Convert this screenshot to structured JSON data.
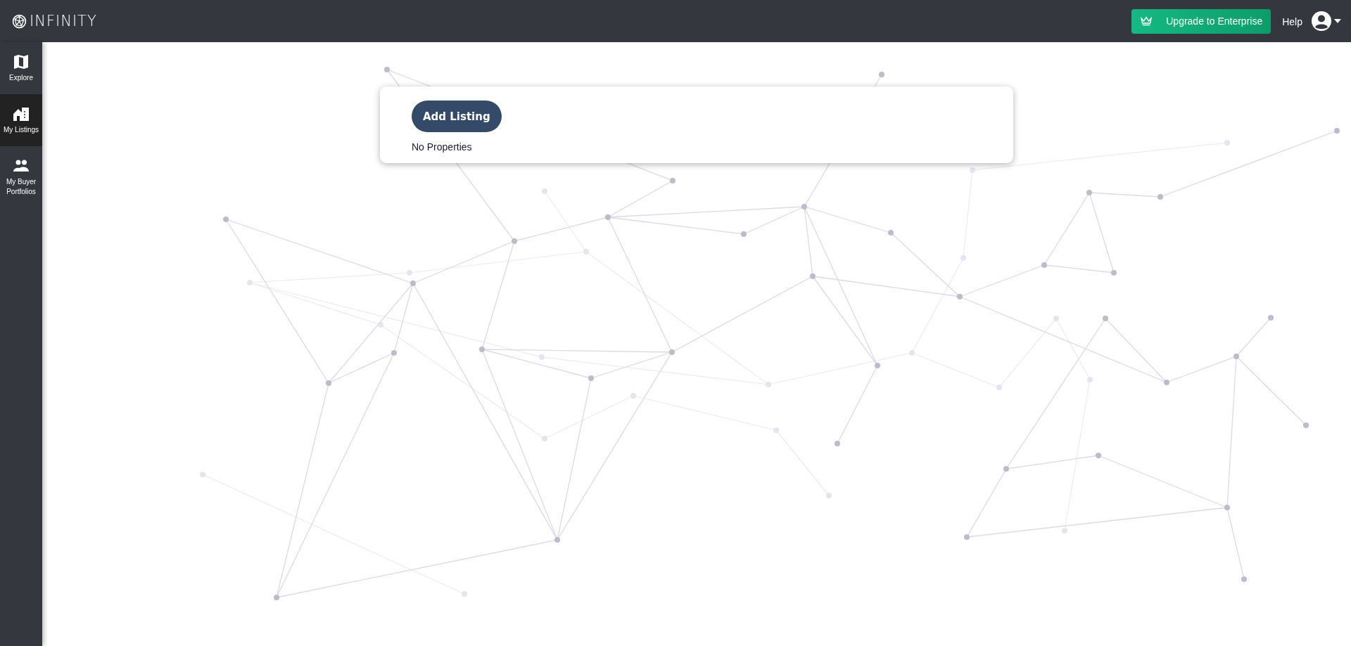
{
  "header": {
    "logo": "INFINITY",
    "upgrade_button": "Upgrade to Enterprise",
    "help": "Help"
  },
  "sidebar": {
    "items": [
      {
        "label": "Explore",
        "selected": false
      },
      {
        "label": "My Listings",
        "selected": true
      },
      {
        "label": "My Buyer Portfolios",
        "selected": false
      }
    ]
  },
  "listings": {
    "add_button": "Add Listing",
    "empty_message": "No Properties"
  }
}
